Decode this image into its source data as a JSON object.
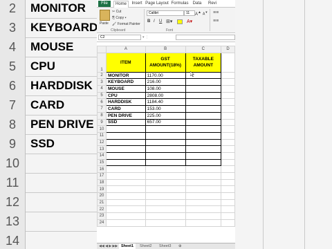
{
  "ribbon_tabs": [
    "File",
    "Home",
    "Insert",
    "Page Layout",
    "Formulas",
    "Data",
    "Revi"
  ],
  "ribbon": {
    "paste": "Paste",
    "cut": "Cut",
    "copy": "Copy ▾",
    "format_painter": "Format Painter",
    "clipboard_label": "Clipboard",
    "font_name": "Calibri",
    "font_size": "11",
    "font_label": "Font",
    "bold": "B",
    "italic": "I",
    "underline": "U"
  },
  "name_box": "C2",
  "columns": [
    "A",
    "B",
    "C",
    "D"
  ],
  "headers": {
    "item": "ITEM",
    "gst": "GST AMOUNT(18%)",
    "taxable": "TAXABLE AMOUNT"
  },
  "rows": [
    {
      "n": "2",
      "item": "MONITOR",
      "gst": "1170.00"
    },
    {
      "n": "3",
      "item": "KEYBOARD",
      "gst": "216.00"
    },
    {
      "n": "4",
      "item": "MOUSE",
      "gst": "108.00"
    },
    {
      "n": "5",
      "item": "CPU",
      "gst": "2808.00"
    },
    {
      "n": "6",
      "item": "HARDDISK",
      "gst": "1184.40"
    },
    {
      "n": "7",
      "item": "CARD",
      "gst": "153.00"
    },
    {
      "n": "8",
      "item": "PEN DRIVE",
      "gst": "225.00"
    },
    {
      "n": "9",
      "item": "SSD",
      "gst": "657.00"
    }
  ],
  "empty_rows": [
    "10",
    "11",
    "12",
    "13",
    "14",
    "15",
    "16",
    "17",
    "18",
    "19",
    "20",
    "21",
    "22",
    "23",
    "24"
  ],
  "header_row_number": "1",
  "sheets": [
    "Sheet1",
    "Sheet2",
    "Sheet3"
  ],
  "background_left": [
    {
      "n": "2",
      "t": "MONITOR"
    },
    {
      "n": "3",
      "t": "KEYBOARD"
    },
    {
      "n": "4",
      "t": "MOUSE"
    },
    {
      "n": "5",
      "t": "CPU"
    },
    {
      "n": "6",
      "t": "HARDDISK"
    },
    {
      "n": "7",
      "t": "CARD"
    },
    {
      "n": "8",
      "t": "PEN DRIVE"
    },
    {
      "n": "9",
      "t": "SSD"
    },
    {
      "n": "10",
      "t": ""
    },
    {
      "n": "11",
      "t": ""
    },
    {
      "n": "12",
      "t": ""
    },
    {
      "n": "13",
      "t": ""
    },
    {
      "n": "14",
      "t": ""
    }
  ]
}
